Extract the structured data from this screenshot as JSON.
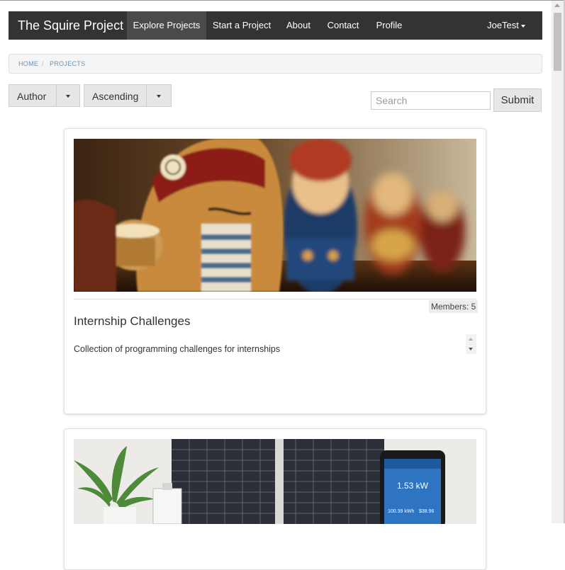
{
  "navbar": {
    "brand": "The Squire Project",
    "items": [
      {
        "label": "Explore Projects",
        "active": true
      },
      {
        "label": "Start a Project"
      },
      {
        "label": "About"
      },
      {
        "label": "Contact"
      },
      {
        "label": "Profile"
      }
    ],
    "user": "JoeTest"
  },
  "breadcrumb": [
    "HOME",
    "PROJECTS"
  ],
  "breadcrumb_separator": "/",
  "sort": {
    "field_label": "Author",
    "order_label": "Ascending"
  },
  "search": {
    "placeholder": "Search",
    "value": "",
    "submit_label": "Submit"
  },
  "projects": [
    {
      "members_label": "Members: 5",
      "title": "Internship Challenges",
      "description": "Collection of programming challenges for internships"
    },
    {
      "phone_reading": "1.53 kW",
      "stat_left": "100.39 kWh",
      "stat_right": "$38.96"
    }
  ],
  "colors": {
    "navbar": "#333333",
    "navbar_active": "#4a4a4a",
    "breadcrumb_link": "#6a8fb8",
    "button_bg": "#e6e6e6"
  }
}
